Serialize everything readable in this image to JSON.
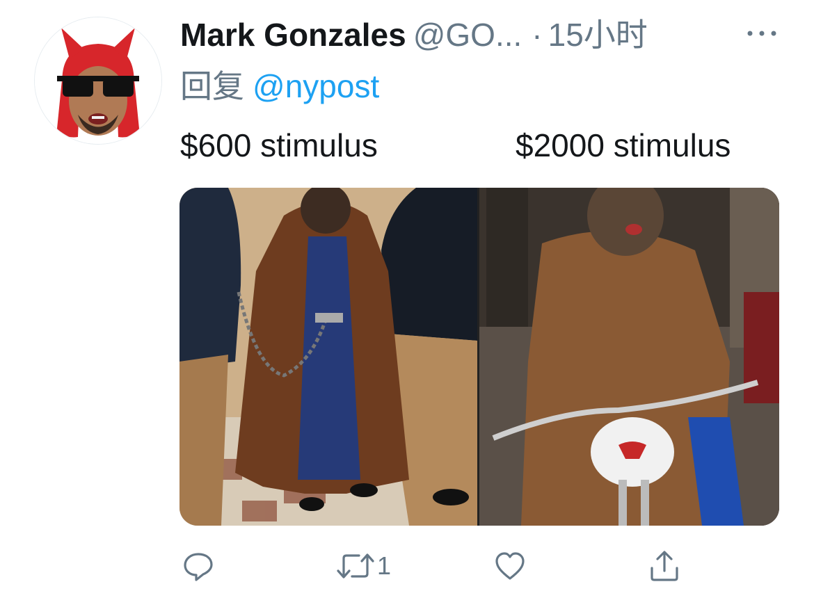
{
  "tweet": {
    "display_name": "Mark Gonzales",
    "handle": "@GO...",
    "separator": "·",
    "time": "15小时",
    "more_label": "···",
    "reply_prefix": "回复",
    "reply_to": "@nypost",
    "text_left": "$600 stimulus",
    "text_right": "$2000 stimulus"
  },
  "actions": {
    "reply_count": "",
    "retweet_count": "1",
    "like_count": "",
    "share_label": ""
  },
  "icons": {
    "avatar": "devil-hat-sunglasses-avatar",
    "more": "more-dots-icon",
    "reply": "reply-bubble-icon",
    "retweet": "retweet-icon",
    "like": "heart-icon",
    "share": "share-upload-icon"
  },
  "colors": {
    "text": "#14171a",
    "muted": "#657786",
    "link": "#1da1f2"
  }
}
